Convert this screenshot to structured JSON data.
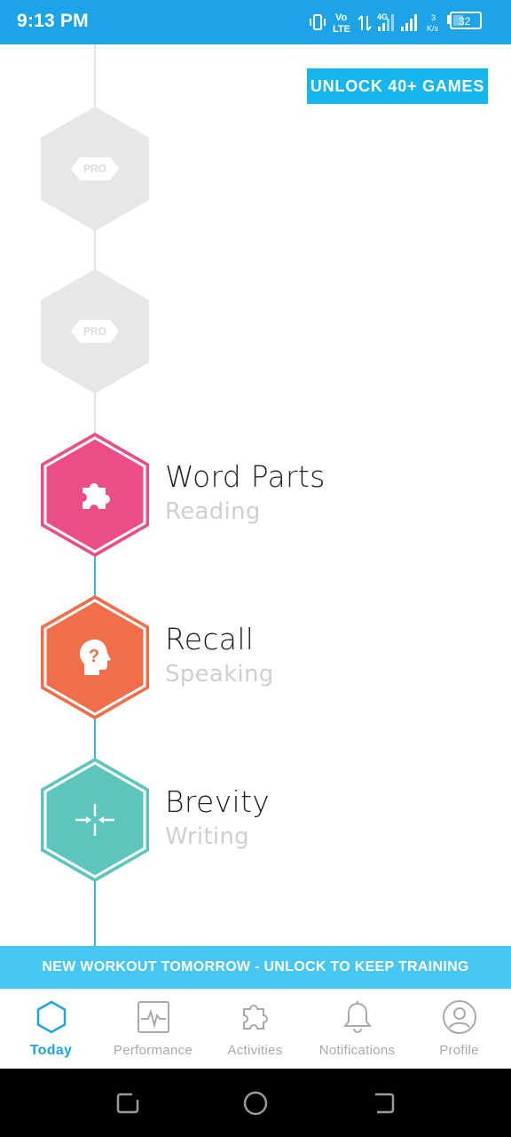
{
  "status_bar": {
    "time": "9:13 PM",
    "network_vo": "Vo",
    "network_lte": "LTE",
    "network_4g": "4G",
    "speed_value": "3",
    "speed_unit": "K/s",
    "battery_level": "32"
  },
  "header": {
    "unlock_button_label": "UNLOCK 40+ GAMES"
  },
  "games": [
    {
      "locked": true,
      "badge": "PRO"
    },
    {
      "locked": true,
      "badge": "PRO"
    },
    {
      "locked": false,
      "title": "Word Parts",
      "subtitle": "Reading",
      "color": "#ec4d86",
      "icon": "puzzle-icon"
    },
    {
      "locked": false,
      "title": "Recall",
      "subtitle": "Speaking",
      "color": "#f26d4a",
      "icon": "head-question-icon"
    },
    {
      "locked": false,
      "title": "Brevity",
      "subtitle": "Writing",
      "color": "#5cc6bd",
      "icon": "compress-arrows-icon"
    }
  ],
  "banner": {
    "text": "NEW WORKOUT TOMORROW - UNLOCK TO KEEP TRAINING"
  },
  "tabs": [
    {
      "label": "Today",
      "icon": "hexagon-icon",
      "active": true
    },
    {
      "label": "Performance",
      "icon": "pulse-chart-icon",
      "active": false
    },
    {
      "label": "Activities",
      "icon": "puzzle-icon",
      "active": false
    },
    {
      "label": "Notifications",
      "icon": "bell-icon",
      "active": false
    },
    {
      "label": "Profile",
      "icon": "user-icon",
      "active": false
    }
  ],
  "colors": {
    "accent": "#1ca6e6",
    "status_bar": "#1da4e8",
    "banner": "#48c6f2",
    "locked_hex": "#e7e7e7"
  }
}
